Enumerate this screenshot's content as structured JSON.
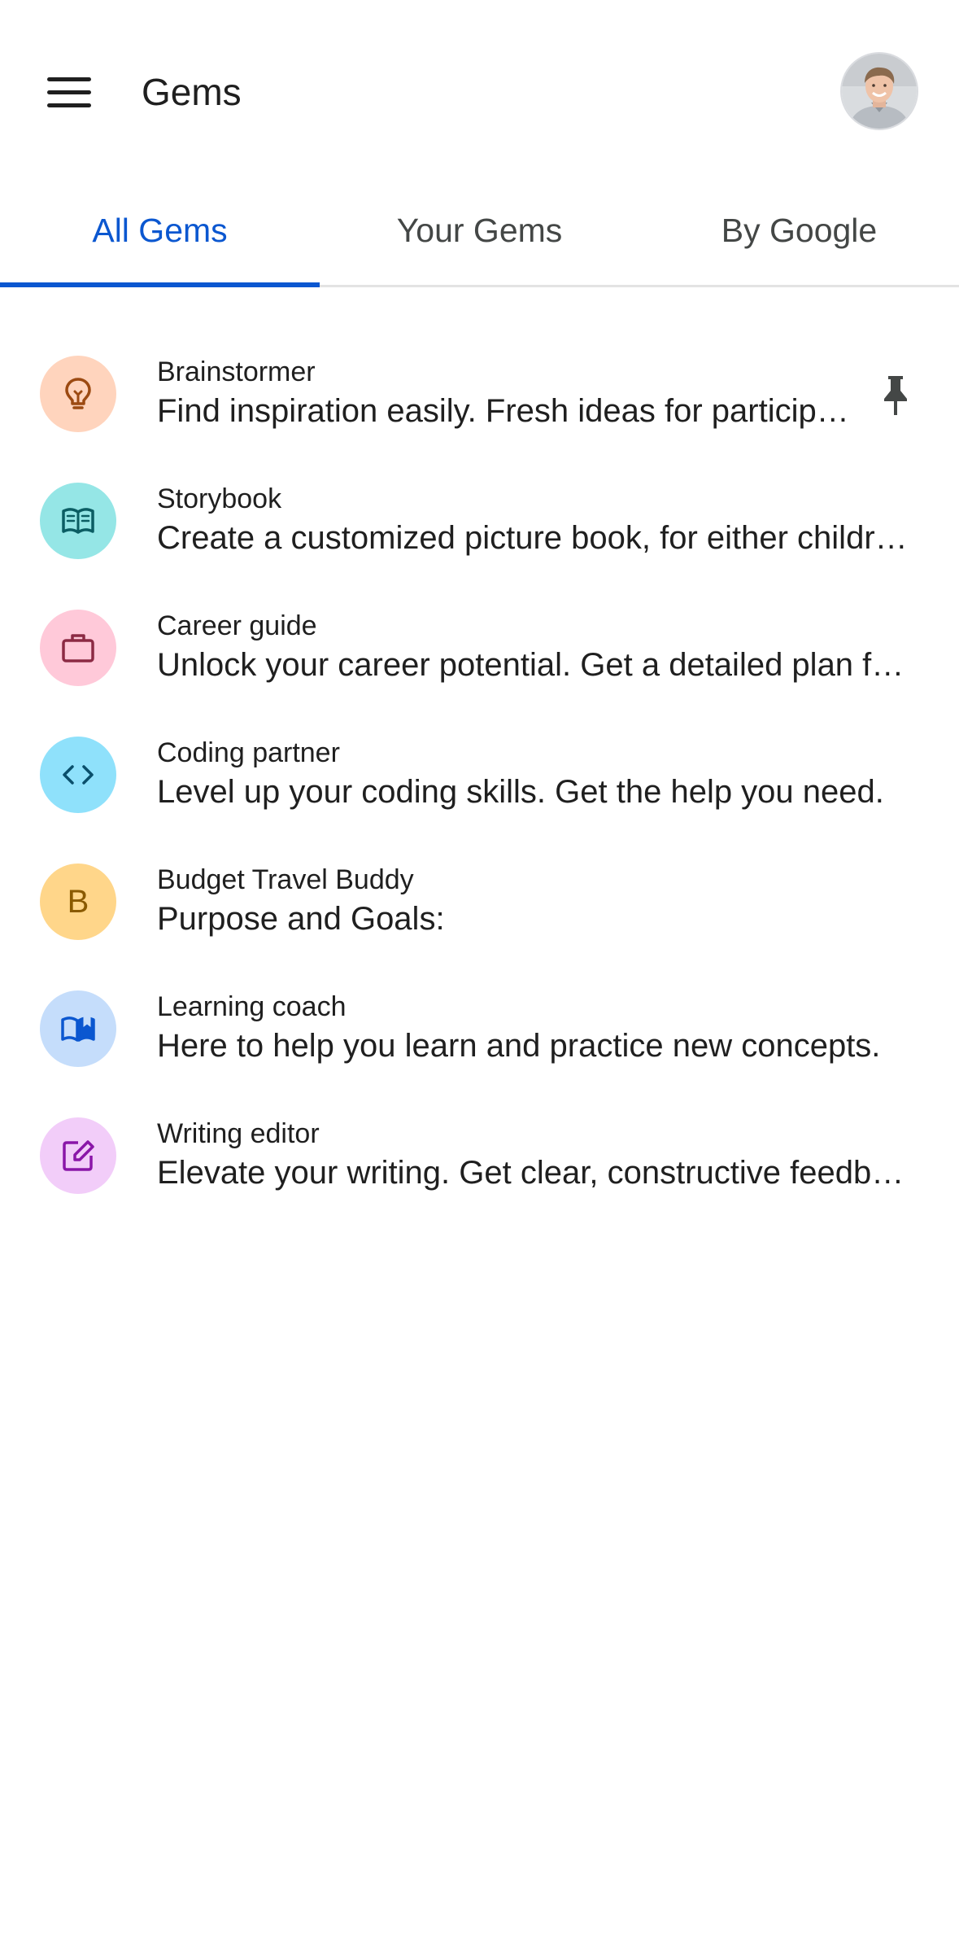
{
  "header": {
    "title": "Gems",
    "menu_icon": "hamburger-menu-icon",
    "avatar_icon": "user-avatar"
  },
  "tabs": [
    {
      "label": "All Gems",
      "active": true
    },
    {
      "label": "Your Gems",
      "active": false
    },
    {
      "label": "By Google",
      "active": false
    }
  ],
  "gems": [
    {
      "name": "Brainstormer",
      "description": "Find inspiration easily. Fresh ideas for participants and events.",
      "icon": "lightbulb-icon",
      "icon_bg": "#ffd4bd",
      "icon_color": "#9c4a12",
      "pinned": true
    },
    {
      "name": "Storybook",
      "description": "Create a customized picture book, for either children or adults.",
      "icon": "book-icon",
      "icon_bg": "#95e6e6",
      "icon_color": "#0b5d63"
    },
    {
      "name": "Career guide",
      "description": "Unlock your career potential. Get a detailed plan for success.",
      "icon": "briefcase-icon",
      "icon_bg": "#ffc9d9",
      "icon_color": "#8c2a44"
    },
    {
      "name": "Coding partner",
      "description": "Level up your coding skills. Get the help you need.",
      "icon": "code-icon",
      "icon_bg": "#8fe1fb",
      "icon_color": "#0a4f6b"
    },
    {
      "name": "Budget Travel Buddy",
      "description": "Purpose and Goals:",
      "icon": "letter-b-icon",
      "letter": "B",
      "icon_bg": "#ffd68a",
      "icon_color": "#8a5a00"
    },
    {
      "name": "Learning coach",
      "description": "Here to help you learn and practice new concepts.",
      "icon": "open-book-icon",
      "icon_bg": "#c5ddfb",
      "icon_color": "#0b57d0"
    },
    {
      "name": "Writing editor",
      "description": "Elevate your writing. Get clear, constructive feedback.",
      "icon": "edit-note-icon",
      "icon_bg": "#f2cdf9",
      "icon_color": "#8a16a8"
    }
  ],
  "pin_icon": "pin-icon"
}
